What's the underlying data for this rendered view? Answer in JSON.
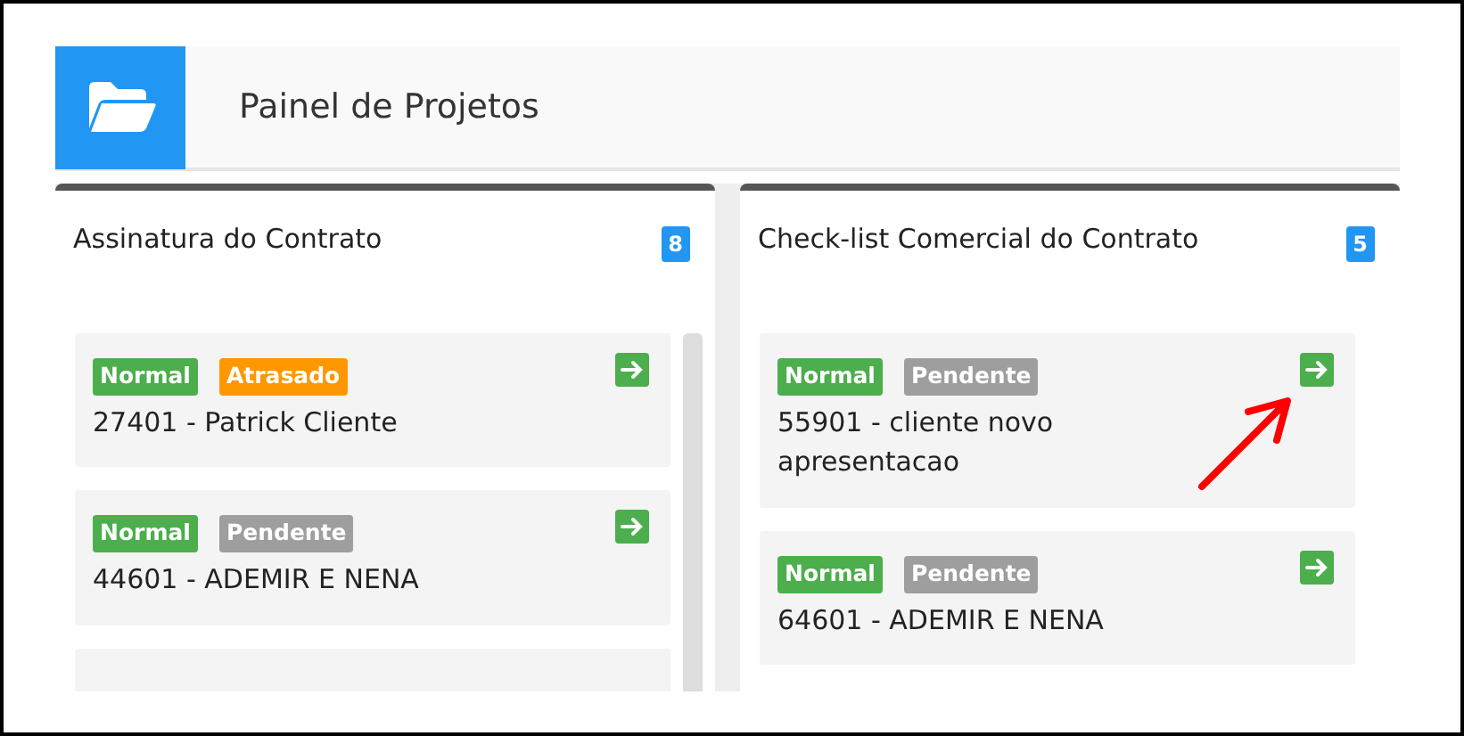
{
  "header": {
    "title": "Painel de Projetos"
  },
  "columns": [
    {
      "title": "Assinatura do Contrato",
      "count": "8",
      "scrollbar": true,
      "cards": [
        {
          "kind": "full",
          "tags": [
            {
              "label": "Normal",
              "color": "#4cae4c"
            },
            {
              "label": "Atrasado",
              "color": "#ff9800"
            }
          ],
          "text": "27401 - Patrick Cliente"
        },
        {
          "kind": "full",
          "tags": [
            {
              "label": "Normal",
              "color": "#4cae4c"
            },
            {
              "label": "Pendente",
              "color": "#9e9e9e"
            }
          ],
          "text": "44601 - ADEMIR E NENA"
        },
        {
          "kind": "partial"
        }
      ]
    },
    {
      "title": "Check-list Comercial do Contrato",
      "count": "5",
      "scrollbar": false,
      "cards": [
        {
          "kind": "full",
          "tags": [
            {
              "label": "Normal",
              "color": "#4cae4c"
            },
            {
              "label": "Pendente",
              "color": "#9e9e9e"
            }
          ],
          "text": "55901 - cliente novo apresentacao",
          "annotated": true
        },
        {
          "kind": "full",
          "tags": [
            {
              "label": "Normal",
              "color": "#4cae4c"
            },
            {
              "label": "Pendente",
              "color": "#9e9e9e"
            }
          ],
          "text": "64601 - ADEMIR E NENA"
        }
      ]
    }
  ]
}
